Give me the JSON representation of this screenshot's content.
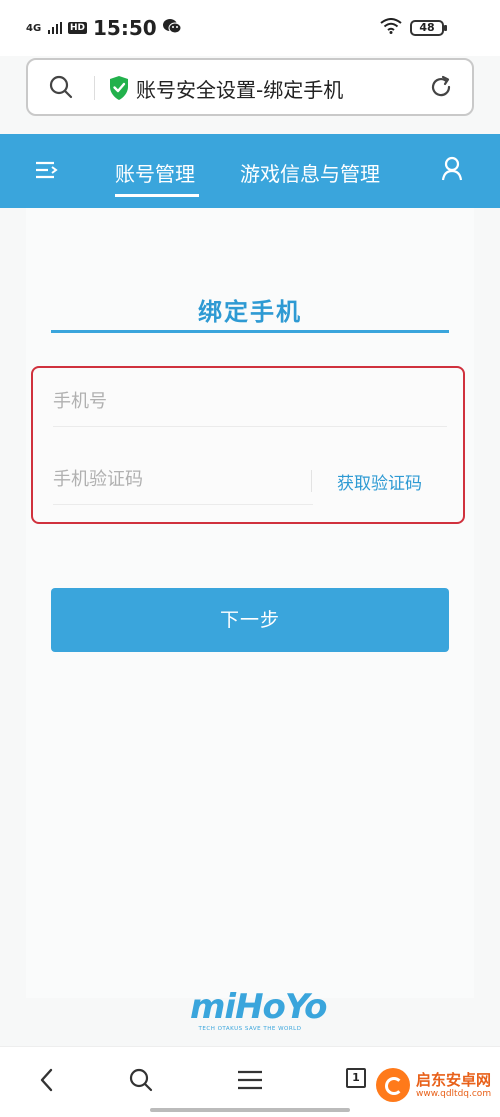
{
  "status_bar": {
    "network": "4G",
    "hd": "HD",
    "time": "15:50",
    "battery": "48"
  },
  "address_bar": {
    "title": "账号安全设置-绑定手机"
  },
  "nav": {
    "tabs": [
      "账号管理",
      "游戏信息与管理"
    ],
    "active_tab": "账号管理"
  },
  "page": {
    "title": "绑定手机",
    "phone_placeholder": "手机号",
    "code_placeholder": "手机验证码",
    "get_code_label": "获取验证码",
    "next_button": "下一步"
  },
  "logo": {
    "brand": "miHoYo",
    "tagline": "TECH OTAKUS SAVE THE WORLD"
  },
  "bottom_bar": {
    "tab_count": "1"
  },
  "watermark": {
    "line1": "启东安卓网",
    "line2": "www.qdltdq.com"
  },
  "colors": {
    "accent": "#3aa5dc",
    "highlight_border": "#d0313d",
    "shield": "#22b14c"
  }
}
